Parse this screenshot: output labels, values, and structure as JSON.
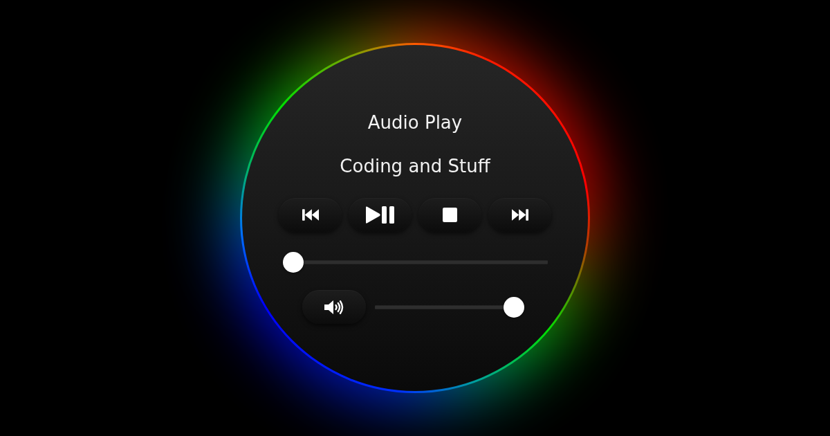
{
  "player": {
    "title": "Audio Play",
    "subtitle": "Coding and Stuff",
    "controls": [
      {
        "kind": "previous"
      },
      {
        "kind": "play_pause"
      },
      {
        "kind": "stop"
      },
      {
        "kind": "next"
      }
    ],
    "progress": {
      "level": 0
    },
    "volume": {
      "level": 1
    }
  }
}
